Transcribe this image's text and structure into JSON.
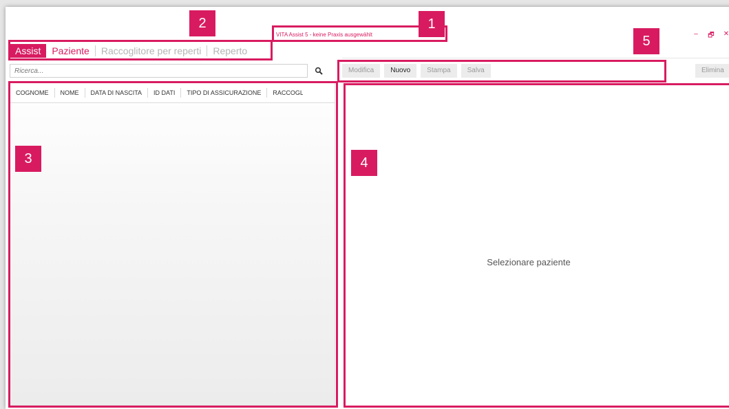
{
  "window": {
    "title": "VITA Assist 5 - keine Praxis ausgewählt",
    "controls": {
      "minimize": "–",
      "restore": "🗗",
      "close": "✕"
    }
  },
  "tabs": [
    {
      "label": "Assist",
      "state": "active"
    },
    {
      "label": "Paziente",
      "state": "highlighted"
    },
    {
      "label": "Raccoglitore per reperti",
      "state": "inactive"
    },
    {
      "label": "Reperto",
      "state": "inactive"
    }
  ],
  "search": {
    "placeholder": "Ricerca...",
    "icon": "search-icon"
  },
  "table": {
    "columns": [
      "COGNOME",
      "NOME",
      "DATA DI NASCITA",
      "ID DATI",
      "TIPO DI ASSICURAZIONE",
      "RACCOGLITO"
    ],
    "rows": []
  },
  "toolbar": {
    "modify": "Modifica",
    "new": "Nuovo",
    "print": "Stampa",
    "save": "Salva",
    "delete": "Elimina"
  },
  "detail": {
    "placeholder": "Selezionare paziente"
  },
  "annotations": {
    "badge1": "1",
    "badge2": "2",
    "badge3": "3",
    "badge4": "4",
    "badge5": "5"
  },
  "colors": {
    "accent": "#d81b60",
    "disabled_text": "#999999",
    "button_bg": "#ececec"
  }
}
